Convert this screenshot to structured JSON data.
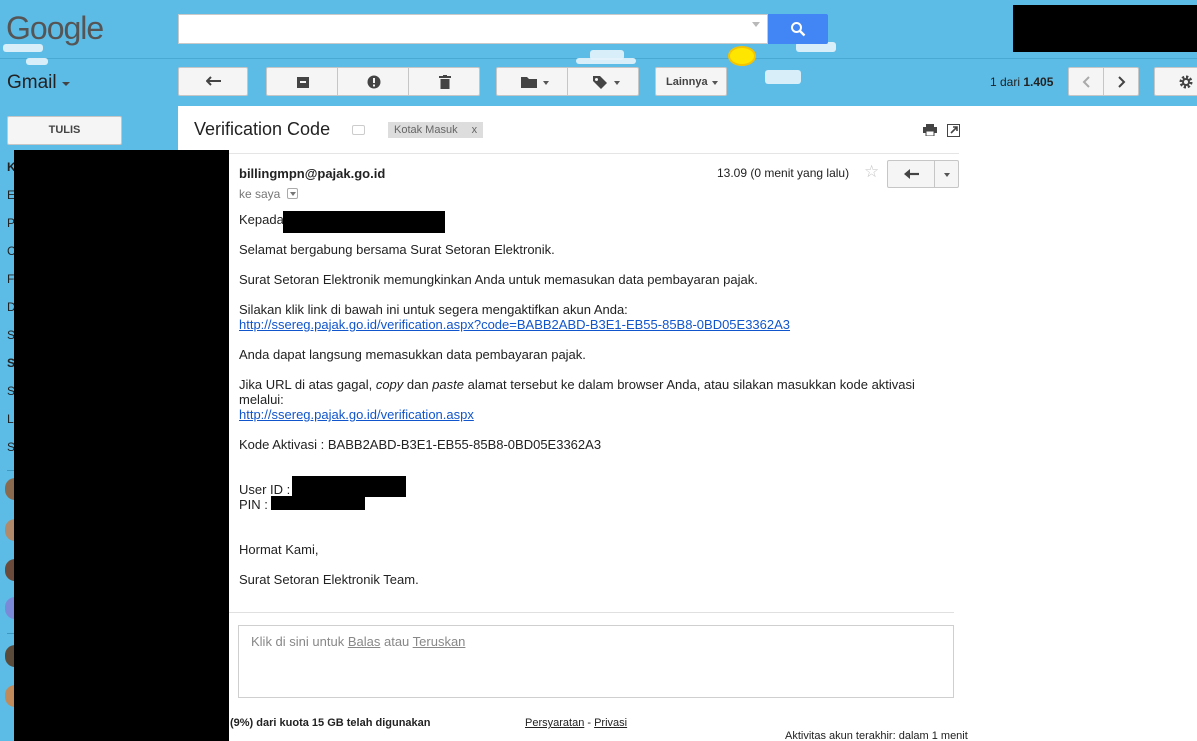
{
  "header": {
    "logo": "Google",
    "search": {
      "value": "",
      "placeholder": ""
    }
  },
  "toolbar": {
    "app_label": "Gmail",
    "more_label": "Lainnya",
    "page_count_prefix": "1 dari ",
    "page_count_total": "1.405"
  },
  "sidebar": {
    "compose_label": "TULIS",
    "visible_letters": [
      "K",
      "E",
      "P",
      "C",
      "F",
      "D",
      "S",
      "S",
      "S",
      "L",
      "S"
    ]
  },
  "message": {
    "subject": "Verification Code",
    "label_chip": "Kotak Masuk",
    "label_chip_close": "x",
    "sender": "billingmpn@pajak.go.id",
    "recipient": "ke saya",
    "timestamp": "13.09 (0 menit yang lalu)",
    "body": {
      "greeting": "Kepada",
      "line1": "Selamat bergabung bersama Surat Setoran Elektronik.",
      "line2": "Surat Setoran Elektronik memungkinkan Anda untuk memasukan data pembayaran pajak.",
      "line3": "Silakan klik link di bawah ini untuk segera mengaktifkan akun Anda:",
      "activation_link": "http://ssereg.pajak.go.id/verification.aspx?code=BABB2ABD-B3E1-EB55-85B8-0BD05E3362A3",
      "line4": "Anda dapat langsung memasukkan data pembayaran pajak.",
      "line5_a": "Jika URL di atas gagal, ",
      "line5_copy": "copy",
      "line5_b": " dan ",
      "line5_paste": "paste",
      "line5_c": " alamat tersebut ke dalam browser Anda, atau silakan masukkan kode aktivasi",
      "line5_d": "melalui:",
      "verification_link": "http://ssereg.pajak.go.id/verification.aspx",
      "activation_code": "Kode Aktivasi : BABB2ABD-B3E1-EB55-85B8-0BD05E3362A3",
      "user_id_label": "User ID :",
      "pin_label": "PIN :",
      "closing": "Hormat Kami,",
      "signature": "Surat Setoran Elektronik Team."
    }
  },
  "reply_box": {
    "prefix": "Klik di sini untuk ",
    "reply": "Balas",
    "or": " atau ",
    "forward": "Teruskan"
  },
  "footer": {
    "quota": "(9%) dari kuota 15 GB telah digunakan",
    "terms": "Persyaratan",
    "separator": " - ",
    "privacy": "Privasi",
    "activity": "Aktivitas akun terakhir: dalam 1 menit"
  },
  "colors": {
    "theme_blue": "#5dbce6",
    "search_button": "#4285f4",
    "link": "#1155cc"
  }
}
